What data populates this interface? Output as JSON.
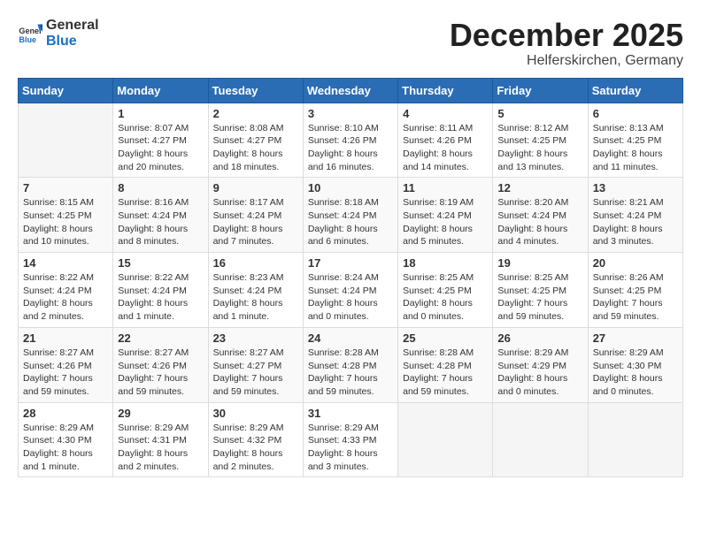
{
  "header": {
    "logo_general": "General",
    "logo_blue": "Blue",
    "month": "December 2025",
    "location": "Helferskirchen, Germany"
  },
  "weekdays": [
    "Sunday",
    "Monday",
    "Tuesday",
    "Wednesday",
    "Thursday",
    "Friday",
    "Saturday"
  ],
  "weeks": [
    [
      {
        "day": "",
        "info": ""
      },
      {
        "day": "1",
        "info": "Sunrise: 8:07 AM\nSunset: 4:27 PM\nDaylight: 8 hours\nand 20 minutes."
      },
      {
        "day": "2",
        "info": "Sunrise: 8:08 AM\nSunset: 4:27 PM\nDaylight: 8 hours\nand 18 minutes."
      },
      {
        "day": "3",
        "info": "Sunrise: 8:10 AM\nSunset: 4:26 PM\nDaylight: 8 hours\nand 16 minutes."
      },
      {
        "day": "4",
        "info": "Sunrise: 8:11 AM\nSunset: 4:26 PM\nDaylight: 8 hours\nand 14 minutes."
      },
      {
        "day": "5",
        "info": "Sunrise: 8:12 AM\nSunset: 4:25 PM\nDaylight: 8 hours\nand 13 minutes."
      },
      {
        "day": "6",
        "info": "Sunrise: 8:13 AM\nSunset: 4:25 PM\nDaylight: 8 hours\nand 11 minutes."
      }
    ],
    [
      {
        "day": "7",
        "info": "Sunrise: 8:15 AM\nSunset: 4:25 PM\nDaylight: 8 hours\nand 10 minutes."
      },
      {
        "day": "8",
        "info": "Sunrise: 8:16 AM\nSunset: 4:24 PM\nDaylight: 8 hours\nand 8 minutes."
      },
      {
        "day": "9",
        "info": "Sunrise: 8:17 AM\nSunset: 4:24 PM\nDaylight: 8 hours\nand 7 minutes."
      },
      {
        "day": "10",
        "info": "Sunrise: 8:18 AM\nSunset: 4:24 PM\nDaylight: 8 hours\nand 6 minutes."
      },
      {
        "day": "11",
        "info": "Sunrise: 8:19 AM\nSunset: 4:24 PM\nDaylight: 8 hours\nand 5 minutes."
      },
      {
        "day": "12",
        "info": "Sunrise: 8:20 AM\nSunset: 4:24 PM\nDaylight: 8 hours\nand 4 minutes."
      },
      {
        "day": "13",
        "info": "Sunrise: 8:21 AM\nSunset: 4:24 PM\nDaylight: 8 hours\nand 3 minutes."
      }
    ],
    [
      {
        "day": "14",
        "info": "Sunrise: 8:22 AM\nSunset: 4:24 PM\nDaylight: 8 hours\nand 2 minutes."
      },
      {
        "day": "15",
        "info": "Sunrise: 8:22 AM\nSunset: 4:24 PM\nDaylight: 8 hours\nand 1 minute."
      },
      {
        "day": "16",
        "info": "Sunrise: 8:23 AM\nSunset: 4:24 PM\nDaylight: 8 hours\nand 1 minute."
      },
      {
        "day": "17",
        "info": "Sunrise: 8:24 AM\nSunset: 4:24 PM\nDaylight: 8 hours\nand 0 minutes."
      },
      {
        "day": "18",
        "info": "Sunrise: 8:25 AM\nSunset: 4:25 PM\nDaylight: 8 hours\nand 0 minutes."
      },
      {
        "day": "19",
        "info": "Sunrise: 8:25 AM\nSunset: 4:25 PM\nDaylight: 7 hours\nand 59 minutes."
      },
      {
        "day": "20",
        "info": "Sunrise: 8:26 AM\nSunset: 4:25 PM\nDaylight: 7 hours\nand 59 minutes."
      }
    ],
    [
      {
        "day": "21",
        "info": "Sunrise: 8:27 AM\nSunset: 4:26 PM\nDaylight: 7 hours\nand 59 minutes."
      },
      {
        "day": "22",
        "info": "Sunrise: 8:27 AM\nSunset: 4:26 PM\nDaylight: 7 hours\nand 59 minutes."
      },
      {
        "day": "23",
        "info": "Sunrise: 8:27 AM\nSunset: 4:27 PM\nDaylight: 7 hours\nand 59 minutes."
      },
      {
        "day": "24",
        "info": "Sunrise: 8:28 AM\nSunset: 4:28 PM\nDaylight: 7 hours\nand 59 minutes."
      },
      {
        "day": "25",
        "info": "Sunrise: 8:28 AM\nSunset: 4:28 PM\nDaylight: 7 hours\nand 59 minutes."
      },
      {
        "day": "26",
        "info": "Sunrise: 8:29 AM\nSunset: 4:29 PM\nDaylight: 8 hours\nand 0 minutes."
      },
      {
        "day": "27",
        "info": "Sunrise: 8:29 AM\nSunset: 4:30 PM\nDaylight: 8 hours\nand 0 minutes."
      }
    ],
    [
      {
        "day": "28",
        "info": "Sunrise: 8:29 AM\nSunset: 4:30 PM\nDaylight: 8 hours\nand 1 minute."
      },
      {
        "day": "29",
        "info": "Sunrise: 8:29 AM\nSunset: 4:31 PM\nDaylight: 8 hours\nand 2 minutes."
      },
      {
        "day": "30",
        "info": "Sunrise: 8:29 AM\nSunset: 4:32 PM\nDaylight: 8 hours\nand 2 minutes."
      },
      {
        "day": "31",
        "info": "Sunrise: 8:29 AM\nSunset: 4:33 PM\nDaylight: 8 hours\nand 3 minutes."
      },
      {
        "day": "",
        "info": ""
      },
      {
        "day": "",
        "info": ""
      },
      {
        "day": "",
        "info": ""
      }
    ]
  ]
}
